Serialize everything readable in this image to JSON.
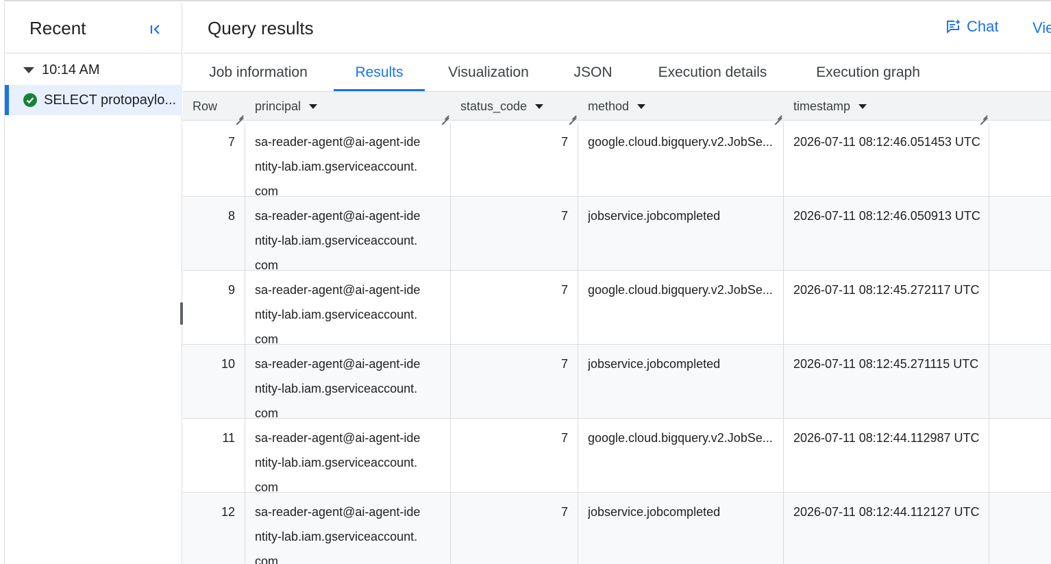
{
  "sidebar": {
    "title": "Recent",
    "time_group": "10:14 AM",
    "job_label": "SELECT protopaylo..."
  },
  "main": {
    "title": "Query results",
    "chat_label": "Chat",
    "view_label": "Vie"
  },
  "tabs": [
    {
      "label": "Job information",
      "active": false
    },
    {
      "label": "Results",
      "active": true
    },
    {
      "label": "Visualization",
      "active": false
    },
    {
      "label": "JSON",
      "active": false
    },
    {
      "label": "Execution details",
      "active": false
    },
    {
      "label": "Execution graph",
      "active": false
    }
  ],
  "table": {
    "columns": [
      "Row",
      "principal",
      "status_code",
      "method",
      "timestamp"
    ],
    "rows": [
      {
        "row": "7",
        "principal": [
          "sa-reader-agent@ai-agent-ide",
          "ntity-lab.iam.gserviceaccount.",
          "com"
        ],
        "status_code": "7",
        "method": "google.cloud.bigquery.v2.JobSe...",
        "timestamp": "2026-07-11 08:12:46.051453 UTC"
      },
      {
        "row": "8",
        "principal": [
          "sa-reader-agent@ai-agent-ide",
          "ntity-lab.iam.gserviceaccount.",
          "com"
        ],
        "status_code": "7",
        "method": "jobservice.jobcompleted",
        "timestamp": "2026-07-11 08:12:46.050913 UTC"
      },
      {
        "row": "9",
        "principal": [
          "sa-reader-agent@ai-agent-ide",
          "ntity-lab.iam.gserviceaccount.",
          "com"
        ],
        "status_code": "7",
        "method": "google.cloud.bigquery.v2.JobSe...",
        "timestamp": "2026-07-11 08:12:45.272117 UTC"
      },
      {
        "row": "10",
        "principal": [
          "sa-reader-agent@ai-agent-ide",
          "ntity-lab.iam.gserviceaccount.",
          "com"
        ],
        "status_code": "7",
        "method": "jobservice.jobcompleted",
        "timestamp": "2026-07-11 08:12:45.271115 UTC"
      },
      {
        "row": "11",
        "principal": [
          "sa-reader-agent@ai-agent-ide",
          "ntity-lab.iam.gserviceaccount.",
          "com"
        ],
        "status_code": "7",
        "method": "google.cloud.bigquery.v2.JobSe...",
        "timestamp": "2026-07-11 08:12:44.112987 UTC"
      },
      {
        "row": "12",
        "principal": [
          "sa-reader-agent@ai-agent-ide",
          "ntity-lab.iam.gserviceaccount.",
          "com"
        ],
        "status_code": "7",
        "method": "jobservice.jobcompleted",
        "timestamp": "2026-07-11 08:12:44.112127 UTC"
      }
    ]
  },
  "colors": {
    "accent": "#1a73e8",
    "success": "#188038",
    "selected_bg": "#e8f0fe"
  },
  "icons": {
    "collapse": "collapse-left-icon",
    "expand": "caret-down-icon",
    "status": "check-circle-icon",
    "chat": "chat-sparkle-icon",
    "sort": "sort-caret-icon"
  }
}
